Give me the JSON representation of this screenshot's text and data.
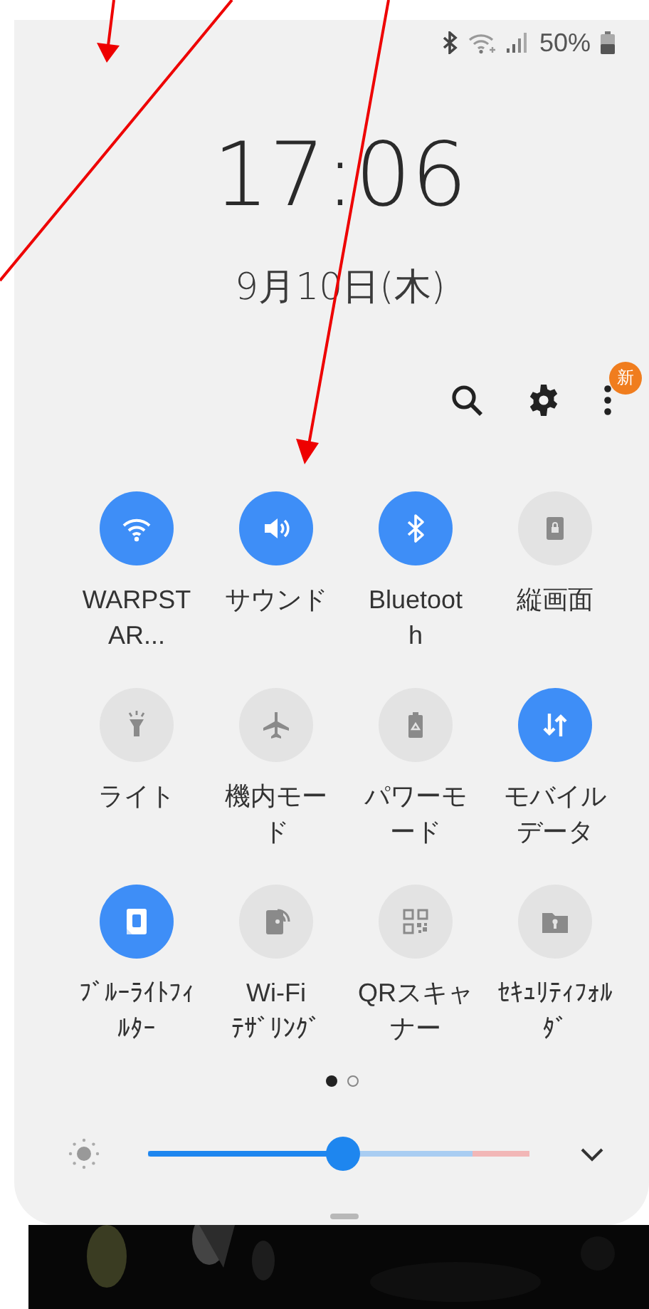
{
  "status_bar": {
    "battery": "50%"
  },
  "clock": {
    "time": "17:06",
    "date": "9月10日(木)"
  },
  "toolbar": {
    "badge": "新"
  },
  "tiles": [
    {
      "kind": "wifi",
      "label": "WARPST\nAR...",
      "on": true
    },
    {
      "kind": "sound",
      "label": "サウンド",
      "on": true
    },
    {
      "kind": "bluetooth",
      "label": "Bluetoot\nh",
      "on": true
    },
    {
      "kind": "rotation",
      "label": "縦画面",
      "on": false
    },
    {
      "kind": "flashlight",
      "label": "ライト",
      "on": false
    },
    {
      "kind": "airplane",
      "label": "機内モード",
      "on": false
    },
    {
      "kind": "power",
      "label": "パワーモード",
      "on": false
    },
    {
      "kind": "data",
      "label": "モバイルデータ",
      "on": true
    },
    {
      "kind": "bluelight",
      "label": "ﾌﾞﾙｰﾗｲﾄﾌｨﾙﾀｰ",
      "on": true
    },
    {
      "kind": "hotspot",
      "label": "Wi-Fi\nﾃｻﾞﾘﾝｸﾞ",
      "on": false
    },
    {
      "kind": "qr",
      "label": "QRスキャナー",
      "on": false
    },
    {
      "kind": "folder",
      "label": "ｾｷｭﾘﾃｨﾌｫﾙﾀﾞ",
      "on": false
    }
  ],
  "page_dots": [
    {
      "selected": true
    },
    {
      "selected": false
    }
  ],
  "brightness": {
    "level": 0.51
  }
}
